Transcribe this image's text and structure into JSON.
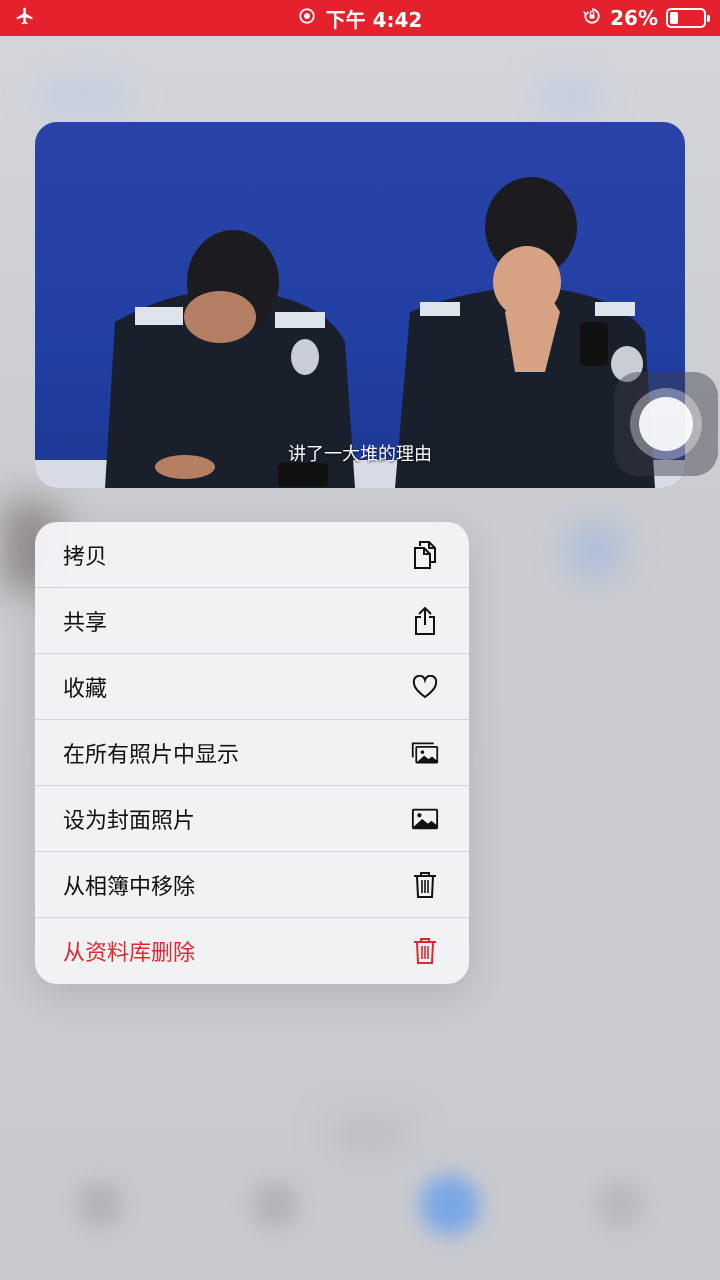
{
  "status_bar": {
    "time": "下午 4:42",
    "battery_percent": "26%",
    "battery_level": 0.26,
    "icons": [
      "airplane-icon",
      "location-icon",
      "rotation-lock-icon",
      "battery-icon"
    ]
  },
  "preview": {
    "subtitle": "讲了一大堆的理由"
  },
  "menu": {
    "items": [
      {
        "label": "拷贝",
        "icon": "copy-icon"
      },
      {
        "label": "共享",
        "icon": "share-icon"
      },
      {
        "label": "收藏",
        "icon": "heart-icon"
      },
      {
        "label": "在所有照片中显示",
        "icon": "photos-stack-icon"
      },
      {
        "label": "设为封面照片",
        "icon": "photo-icon"
      },
      {
        "label": "从相簿中移除",
        "icon": "trash-icon"
      },
      {
        "label": "从资料库删除",
        "icon": "trash-red-icon"
      }
    ]
  },
  "colors": {
    "status_bar": "#e4212c",
    "danger": "#e0262f",
    "preview_background": "#2140a4"
  }
}
